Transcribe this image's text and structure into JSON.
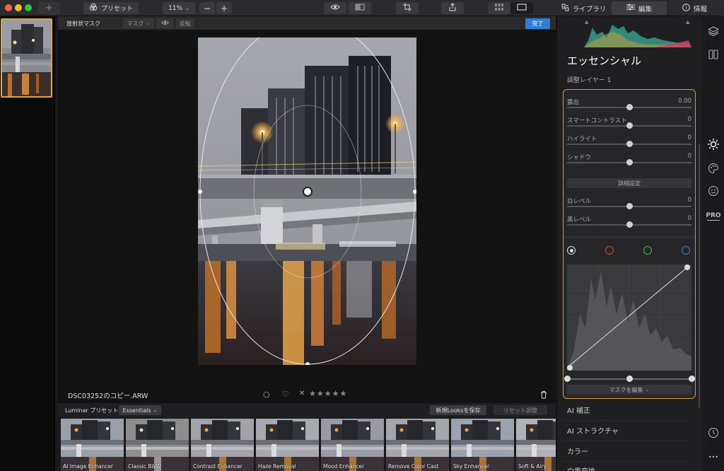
{
  "toolbar": {
    "add_label": "+",
    "presets_label": "プリセット",
    "zoom_value": "11%",
    "zoom_out_label": "−",
    "zoom_in_label": "+"
  },
  "tabs": {
    "library": "ライブラリ",
    "edit": "編集",
    "info": "情報"
  },
  "mask_bar": {
    "title": "放射状マスク",
    "mask_label": "マスク",
    "invert_label": "反転",
    "done_label": "完了"
  },
  "photo": {
    "filename": "DSC03252のコピー.ARW",
    "stars": "★★★★★",
    "reject_mark": "✕",
    "heart": "♡",
    "circle": "○"
  },
  "preset_bar": {
    "label": "Luminar プリセット",
    "category": "Essentials",
    "save_looks": "新規Looksを保存",
    "reset": "リセット調整"
  },
  "presets": [
    {
      "name": "AI Image Enhancer"
    },
    {
      "name": "Classic B&W"
    },
    {
      "name": "Contrast Enhancer"
    },
    {
      "name": "Haze Removal"
    },
    {
      "name": "Mood Enhancer"
    },
    {
      "name": "Remove Color Cast"
    },
    {
      "name": "Sky Enhancer"
    },
    {
      "name": "Soft & Airy"
    }
  ],
  "panel": {
    "title": "エッセンシャル",
    "layer": "調整レイヤー 1",
    "sliders": [
      {
        "label": "露出",
        "value": "0.00"
      },
      {
        "label": "スマートコントラスト",
        "value": "0"
      },
      {
        "label": "ハイライト",
        "value": "0"
      },
      {
        "label": "シャドウ",
        "value": "0"
      },
      {
        "label": "白レベル",
        "value": "0"
      },
      {
        "label": "黒レベル",
        "value": "0"
      }
    ],
    "detail_label": "詳細設定",
    "edit_mask_label": "マスクを編集",
    "sections": [
      "AI 補正",
      "AI ストラクチャ",
      "カラー",
      "白黒変換"
    ]
  },
  "side_icons": {
    "pro_label": "PRO",
    "more_label": "•••"
  },
  "colors": {
    "accent": "#2f7fd6",
    "selection": "#e8a23a",
    "red": "#e0443c",
    "green": "#3cc24a",
    "blue": "#3a74e0"
  }
}
